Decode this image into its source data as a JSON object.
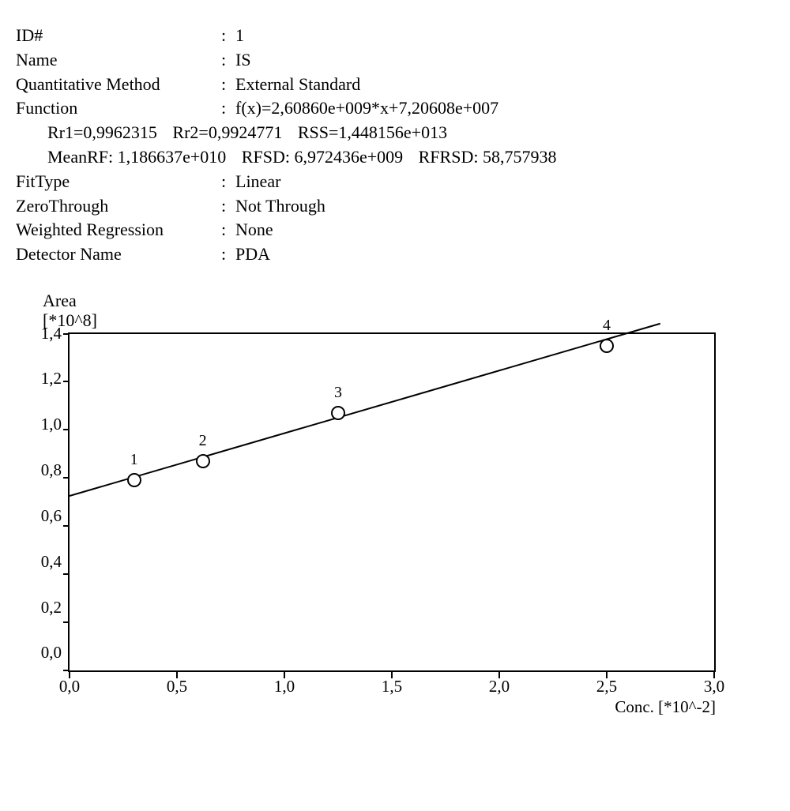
{
  "info": {
    "id_label": "ID#",
    "id_value": "1",
    "name_label": "Name",
    "name_value": "IS",
    "qmethod_label": "Quantitative Method",
    "qmethod_value": "External Standard",
    "function_label": "Function",
    "function_value": "f(x)=2,60860e+009*x+7,20608e+007",
    "rr1_label": "Rr1=0,9962315",
    "rr2_label": "Rr2=0,9924771",
    "rss_label": "RSS=1,448156e+013",
    "meanrf": "MeanRF: 1,186637e+010",
    "rfsd": "RFSD: 6,972436e+009",
    "rfrsd": "RFRSD: 58,757938",
    "fittype_label": "FitType",
    "fittype_value": "Linear",
    "zero_label": "ZeroThrough",
    "zero_value": "Not Through",
    "wr_label": "Weighted Regression",
    "wr_value": "None",
    "detector_label": "Detector Name",
    "detector_value": "PDA"
  },
  "chart": {
    "ylabel_line1": "Area",
    "ylabel_line2": "[*10^8]",
    "xlabel": "Conc. [*10^-2]",
    "yticks": [
      "1,4",
      "1,2",
      "1,0",
      "0,8",
      "0,6",
      "0,4",
      "0,2",
      "0,0"
    ],
    "xticks": [
      "0,0",
      "0,5",
      "1,0",
      "1,5",
      "2,0",
      "2,5",
      "3,0"
    ]
  },
  "chart_data": {
    "type": "scatter",
    "title": "",
    "xlabel": "Conc. [*10^-2]",
    "ylabel": "Area [*10^8]",
    "xlim": [
      0.0,
      3.0
    ],
    "ylim": [
      0.0,
      1.4
    ],
    "series": [
      {
        "name": "IS",
        "points": [
          {
            "label": "1",
            "x": 0.3,
            "y": 0.79
          },
          {
            "label": "2",
            "x": 0.62,
            "y": 0.87
          },
          {
            "label": "3",
            "x": 1.25,
            "y": 1.07
          },
          {
            "label": "4",
            "x": 2.5,
            "y": 1.35
          }
        ]
      }
    ],
    "regression": {
      "type": "linear",
      "slope_per_x": 0.26086,
      "intercept": 0.72061,
      "x_start": 0.0,
      "x_end": 2.75
    }
  }
}
